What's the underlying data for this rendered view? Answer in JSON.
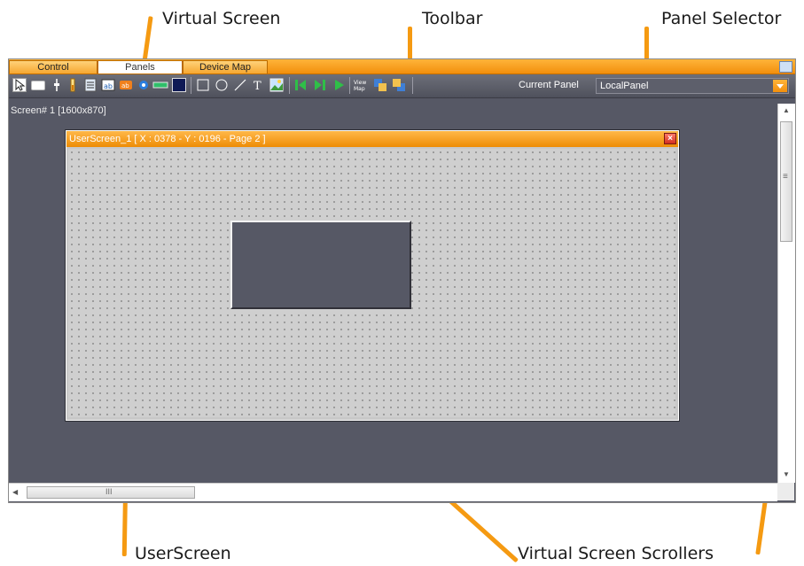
{
  "callouts": {
    "virtual_screen": "Virtual Screen",
    "toolbar": "Toolbar",
    "panel_selector": "Panel Selector",
    "userscreen": "UserScreen",
    "virtual_screen_scrollers": "Virtual Screen Scrollers"
  },
  "tabs": [
    "Control",
    "Panels",
    "Device Map"
  ],
  "active_tab": "Panels",
  "toolbar": {
    "current_panel_label": "Current Panel",
    "current_panel_value": "LocalPanel",
    "tools": [
      "pointer-icon",
      "button-icon",
      "slider-icon",
      "level-meter-icon",
      "list-icon",
      "image-button-icon",
      "text-button-icon",
      "knob-icon",
      "led-icon",
      "panel-rect-icon",
      "rectangle-icon",
      "ellipse-icon",
      "line-icon",
      "text-icon",
      "image-icon",
      "first-page-icon",
      "next-page-icon",
      "play-icon",
      "view-map-icon",
      "bring-front-icon",
      "send-back-icon"
    ]
  },
  "screen": {
    "caption": "Screen# 1 [1600x870]"
  },
  "userscreen": {
    "title": "UserScreen_1 [ X : 0378 - Y : 0196 - Page 2 ]"
  },
  "scrollbar": {
    "h_grip": "III",
    "v_grip": "≡"
  },
  "colors": {
    "accent_orange": "#f59a12",
    "workspace": "#565865",
    "close_red": "#d12d1e"
  }
}
